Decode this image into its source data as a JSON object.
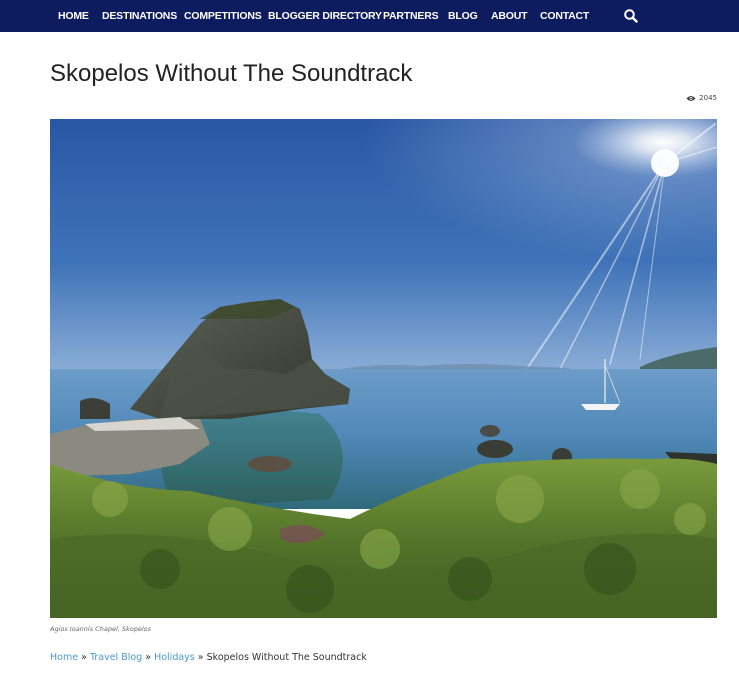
{
  "nav": {
    "items": [
      "HOME",
      "DESTINATIONS",
      "COMPETITIONS",
      "BLOGGER DIRECTORY",
      "PARTNERS",
      "BLOG",
      "ABOUT",
      "CONTACT"
    ],
    "search_icon": "search-icon",
    "background": "#0c1c5e"
  },
  "post": {
    "title": "Skopelos Without The Soundtrack",
    "views": "2045",
    "views_icon": "eye-icon",
    "image_caption": "Agios Ioannis Chapel, Skopelos"
  },
  "breadcrumb": {
    "links": [
      "Home",
      "Travel Blog",
      "Holidays"
    ],
    "separator": "»",
    "current": "Skopelos Without The Soundtrack",
    "link_color": "#4a9ad0"
  }
}
